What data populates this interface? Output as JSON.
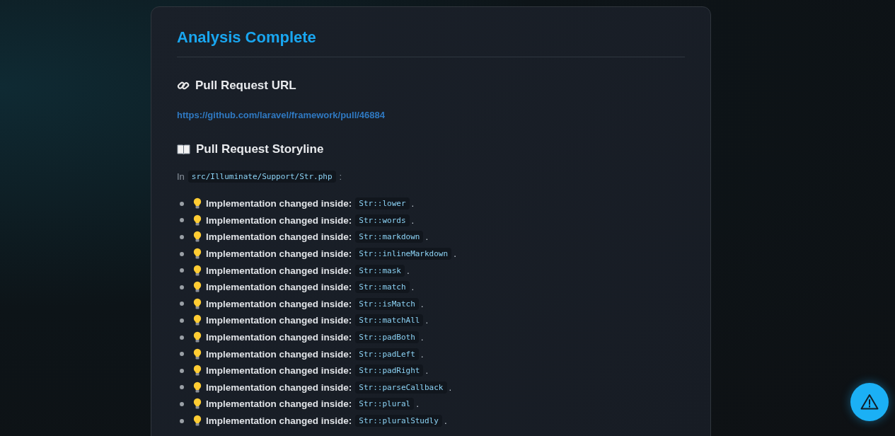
{
  "title": "Analysis Complete",
  "url_section": {
    "heading": "Pull Request URL",
    "link": "https://github.com/laravel/framework/pull/46884"
  },
  "storyline": {
    "heading": "Pull Request Storyline",
    "intro": {
      "prefix": "In",
      "file": "src/Illuminate/Support/Str.php",
      "suffix": ":"
    },
    "items": [
      {
        "label": "Implementation changed inside:",
        "method": "Str::lower",
        "suffix": "."
      },
      {
        "label": "Implementation changed inside:",
        "method": "Str::words",
        "suffix": "."
      },
      {
        "label": "Implementation changed inside:",
        "method": "Str::markdown",
        "suffix": "."
      },
      {
        "label": "Implementation changed inside:",
        "method": "Str::inlineMarkdown",
        "suffix": "."
      },
      {
        "label": "Implementation changed inside:",
        "method": "Str::mask",
        "suffix": "."
      },
      {
        "label": "Implementation changed inside:",
        "method": "Str::match",
        "suffix": "."
      },
      {
        "label": "Implementation changed inside:",
        "method": "Str::isMatch",
        "suffix": "."
      },
      {
        "label": "Implementation changed inside:",
        "method": "Str::matchAll",
        "suffix": "."
      },
      {
        "label": "Implementation changed inside:",
        "method": "Str::padBoth",
        "suffix": "."
      },
      {
        "label": "Implementation changed inside:",
        "method": "Str::padLeft",
        "suffix": "."
      },
      {
        "label": "Implementation changed inside:",
        "method": "Str::padRight",
        "suffix": "."
      },
      {
        "label": "Implementation changed inside:",
        "method": "Str::parseCallback",
        "suffix": "."
      },
      {
        "label": "Implementation changed inside:",
        "method": "Str::plural",
        "suffix": "."
      },
      {
        "label": "Implementation changed inside:",
        "method": "Str::pluralStudly",
        "suffix": "."
      }
    ]
  }
}
